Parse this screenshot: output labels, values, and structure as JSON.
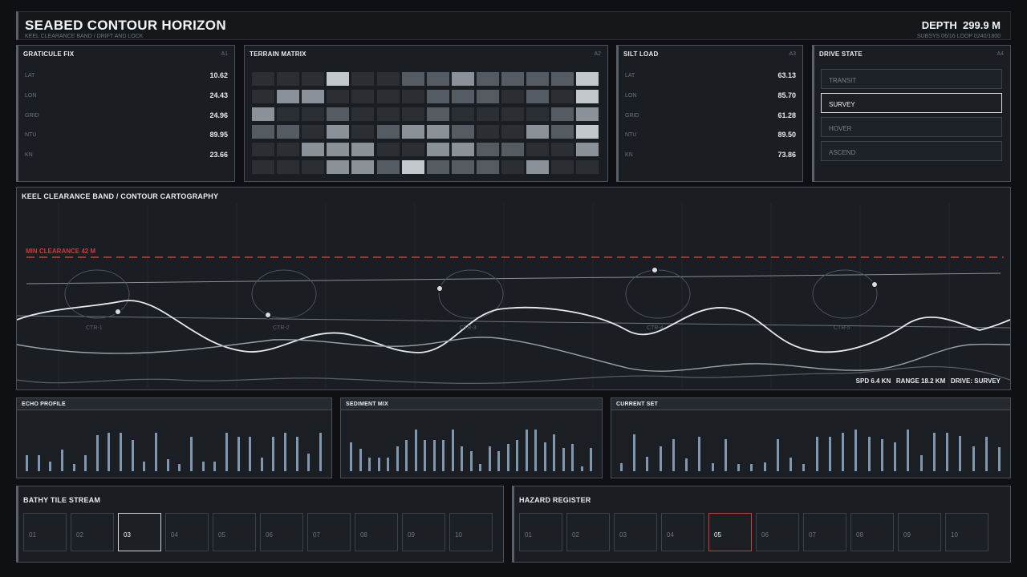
{
  "header": {
    "title": "SEABED CONTOUR HORIZON",
    "subtitle": "KEEL CLEARANCE BAND / DRIFT AND LOCK",
    "depth_label": "DEPTH",
    "depth_value": "299.9 M",
    "subsys": "SUBSYS 06/16  LOOP 0240/1800"
  },
  "graticule": {
    "title": "GRATICULE FIX",
    "id": "A1",
    "rows": [
      {
        "k": "LAT",
        "v": "10.62"
      },
      {
        "k": "LON",
        "v": "24.43"
      },
      {
        "k": "GRID",
        "v": "24.96"
      },
      {
        "k": "NTU",
        "v": "89.95"
      },
      {
        "k": "KN",
        "v": "23.66"
      }
    ]
  },
  "terrain": {
    "title": "TERRAIN MATRIX",
    "id": "A2",
    "shades": [
      [
        1,
        1,
        1,
        4,
        1,
        1,
        2,
        2,
        3,
        2,
        2,
        2,
        2,
        4
      ],
      [
        1,
        3,
        3,
        1,
        1,
        1,
        1,
        2,
        2,
        2,
        1,
        2,
        1,
        4
      ],
      [
        3,
        1,
        1,
        2,
        1,
        1,
        1,
        2,
        1,
        1,
        1,
        1,
        2,
        3
      ],
      [
        2,
        2,
        1,
        3,
        1,
        2,
        3,
        3,
        2,
        1,
        1,
        3,
        2,
        4
      ],
      [
        1,
        1,
        3,
        3,
        3,
        1,
        1,
        3,
        3,
        2,
        2,
        1,
        1,
        3
      ],
      [
        1,
        1,
        1,
        3,
        3,
        2,
        4,
        2,
        2,
        2,
        1,
        3,
        1,
        1
      ]
    ],
    "palette": [
      "#1e2226",
      "#2b2f34",
      "#555b62",
      "#8b9198",
      "#c3c8cd"
    ]
  },
  "silt": {
    "title": "SILT LOAD",
    "id": "A3",
    "rows": [
      {
        "k": "LAT",
        "v": "63.13"
      },
      {
        "k": "LON",
        "v": "85.70"
      },
      {
        "k": "GRID",
        "v": "61.28"
      },
      {
        "k": "NTU",
        "v": "89.50"
      },
      {
        "k": "KN",
        "v": "73.86"
      }
    ]
  },
  "drive": {
    "title": "DRIVE STATE",
    "id": "A4",
    "options": [
      "TRANSIT",
      "SURVEY",
      "HOVER",
      "ASCEND"
    ],
    "selected": "SURVEY"
  },
  "contour": {
    "title": "KEEL CLEARANCE BAND / CONTOUR CARTOGRAPHY",
    "min_clearance": "MIN CLEARANCE 42 M",
    "markers": [
      "CTR-1",
      "CTR-2",
      "CTR-3",
      "CTR-4",
      "CTR-5"
    ],
    "readout": "SPD 6.4 KN   RANGE 18.2 KM   DRIVE: SURVEY",
    "danger_color": "#d23a3a"
  },
  "echo": {
    "title": "ECHO PROFILE",
    "values": [
      0.35,
      0.35,
      0.22,
      0.48,
      0.16,
      0.35,
      0.8,
      0.86,
      0.86,
      0.7,
      0.22,
      0.86,
      0.26,
      0.16,
      0.76,
      0.22,
      0.22,
      0.86,
      0.76,
      0.76,
      0.3,
      0.76,
      0.86,
      0.76,
      0.4,
      0.86
    ]
  },
  "sediment": {
    "title": "SEDIMENT MIX",
    "values": [
      0.64,
      0.5,
      0.3,
      0.3,
      0.3,
      0.55,
      0.7,
      0.92,
      0.7,
      0.7,
      0.7,
      0.92,
      0.56,
      0.44,
      0.16,
      0.56,
      0.44,
      0.6,
      0.7,
      0.92,
      0.92,
      0.64,
      0.82,
      0.52,
      0.6,
      0.1,
      0.52
    ]
  },
  "current": {
    "title": "CURRENT SET",
    "values": [
      0.18,
      0.82,
      0.32,
      0.56,
      0.72,
      0.28,
      0.76,
      0.18,
      0.72,
      0.16,
      0.16,
      0.2,
      0.72,
      0.3,
      0.16,
      0.76,
      0.76,
      0.86,
      0.92,
      0.76,
      0.72,
      0.64,
      0.92,
      0.36,
      0.86,
      0.86,
      0.78,
      0.56,
      0.76,
      0.54
    ]
  },
  "bathy": {
    "title": "BATHY TILE STREAM",
    "tiles": [
      "01",
      "02",
      "03",
      "04",
      "05",
      "06",
      "07",
      "08",
      "09",
      "10"
    ],
    "selected": "03"
  },
  "hazard": {
    "title": "HAZARD REGISTER",
    "tiles": [
      "01",
      "02",
      "03",
      "04",
      "05",
      "06",
      "07",
      "08",
      "09",
      "10"
    ],
    "flagged": "05"
  }
}
